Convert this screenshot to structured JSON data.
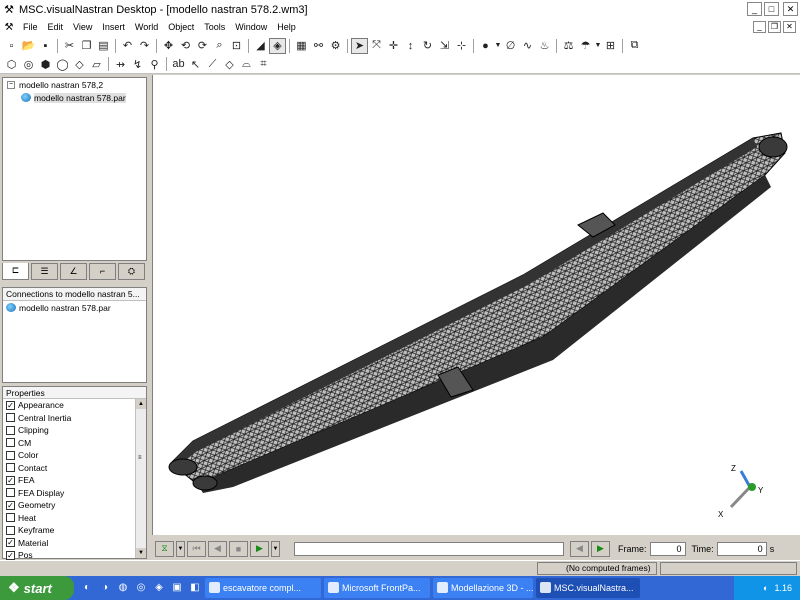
{
  "window": {
    "title": "MSC.visualNastran Desktop - [modello nastran 578.2.wm3]",
    "minimize": "_",
    "maximize": "□",
    "close": "✕"
  },
  "menu": {
    "items": [
      "File",
      "Edit",
      "View",
      "Insert",
      "World",
      "Object",
      "Tools",
      "Window",
      "Help"
    ],
    "doc_minimize": "_",
    "doc_restore": "❐",
    "doc_close": "✕"
  },
  "toolbar1": {
    "icons": [
      "new-icon",
      "open-icon",
      "save-icon",
      "cut-icon",
      "copy-icon",
      "paste-icon",
      "undo-icon",
      "redo-icon",
      "pan-icon",
      "rotate-icon",
      "spin-icon",
      "zoom-icon",
      "zoom-fit-icon",
      "render-icon",
      "wire-icon",
      "grid-icon",
      "connect-icon",
      "constraint-icon",
      "select-icon",
      "move-icon",
      "move-axis-icon",
      "rotate-axis-icon",
      "rotate-object-icon",
      "drag-icon",
      "shape-icon",
      "joint-icon",
      "spring-icon",
      "rope-icon",
      "camera-icon",
      "meter-icon",
      "view-icon"
    ]
  },
  "toolbar2": {
    "icons": [
      "box-icon",
      "sphere-icon",
      "cylinder-icon",
      "ring-icon",
      "rect-icon",
      "plane-icon",
      "coord-icon",
      "point-icon",
      "text-icon",
      "arrow-icon",
      "polygon-icon",
      "curve-icon",
      "sketch-icon"
    ]
  },
  "tree": {
    "root": "modello nastran 578,2",
    "child": "modello nastran 578.par"
  },
  "tabs": [
    "objects-tab",
    "properties-tab",
    "graphs-tab",
    "curves-tab",
    "cameras-tab"
  ],
  "connections": {
    "header": "Connections to modello nastran 5...",
    "item": "modello nastran 578.par"
  },
  "properties": {
    "header": "Properties",
    "items": [
      {
        "label": "Appearance",
        "checked": true
      },
      {
        "label": "Central Inertia",
        "checked": false
      },
      {
        "label": "Clipping",
        "checked": false
      },
      {
        "label": "CM",
        "checked": false
      },
      {
        "label": "Color",
        "checked": false
      },
      {
        "label": "Contact",
        "checked": false
      },
      {
        "label": "FEA",
        "checked": true
      },
      {
        "label": "FEA Display",
        "checked": false
      },
      {
        "label": "Geometry",
        "checked": true
      },
      {
        "label": "Heat",
        "checked": false
      },
      {
        "label": "Keyframe",
        "checked": false
      },
      {
        "label": "Material",
        "checked": true
      },
      {
        "label": "Pos",
        "checked": true
      }
    ]
  },
  "axes": {
    "z": "Z",
    "x": "X",
    "y": "Y"
  },
  "playback": {
    "frame_label": "Frame:",
    "frame_value": "0",
    "time_label": "Time:",
    "time_value": "0",
    "time_unit": "s"
  },
  "status": {
    "text": "(No computed frames)"
  },
  "taskbar": {
    "start": "start",
    "tasks": [
      {
        "label": "escavatore compl...",
        "active": false
      },
      {
        "label": "Microsoft FrontPa...",
        "active": false
      },
      {
        "label": "Modellazione 3D - ...",
        "active": false
      },
      {
        "label": "MSC.visualNastra...",
        "active": true
      }
    ],
    "clock": "1.16"
  }
}
